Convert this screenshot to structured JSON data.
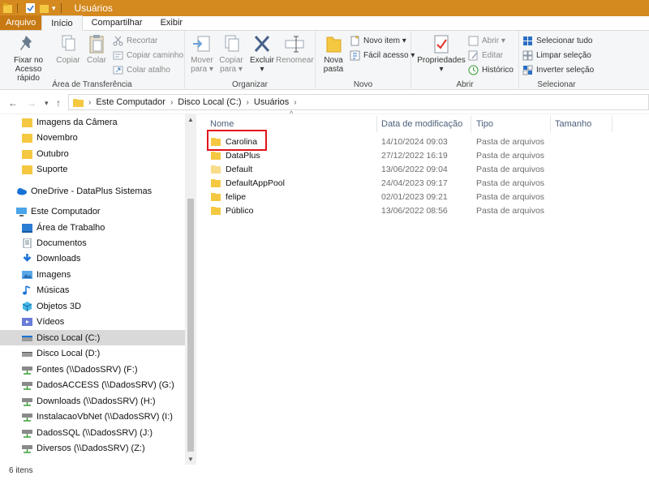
{
  "window": {
    "title": "Usuários"
  },
  "tabs": [
    "Arquivo",
    "Início",
    "Compartilhar",
    "Exibir"
  ],
  "ribbon": {
    "clipboard": {
      "label": "Área de Transferência",
      "pin_label1": "Fixar no",
      "pin_label2": "Acesso rápido",
      "copy_label": "Copiar",
      "paste_label": "Colar",
      "cut_label": "Recortar",
      "copy_path_label": "Copiar caminho",
      "paste_shortcut_label": "Colar atalho"
    },
    "organize": {
      "label": "Organizar",
      "move_label1": "Mover",
      "move_label2": "para ▾",
      "copy_to_label1": "Copiar",
      "copy_to_label2": "para ▾",
      "delete_label1": "Excluir",
      "delete_label2": "▾",
      "rename_label": "Renomear"
    },
    "new": {
      "label": "Novo",
      "new_folder_label1": "Nova",
      "new_folder_label2": "pasta",
      "new_item_label": "Novo item ▾",
      "easy_access_label": "Fácil acesso ▾"
    },
    "open": {
      "label": "Abrir",
      "properties_label1": "Propriedades",
      "properties_label2": "▾",
      "open_label": "Abrir ▾",
      "edit_label": "Editar",
      "history_label": "Histórico"
    },
    "select": {
      "label": "Selecionar",
      "select_all_label": "Selecionar tudo",
      "select_none_label": "Limpar seleção",
      "invert_label": "Inverter seleção"
    }
  },
  "address": {
    "crumbs": [
      "Este Computador",
      "Disco Local (C:)",
      "Usuários"
    ]
  },
  "nav": {
    "items": [
      {
        "label": "Imagens da Câmera",
        "icon": "folder-icon"
      },
      {
        "label": "Novembro",
        "icon": "folder-icon"
      },
      {
        "label": "Outubro",
        "icon": "folder-icon"
      },
      {
        "label": "Suporte",
        "icon": "folder-icon"
      },
      {
        "label": "OneDrive - DataPlus Sistemas",
        "icon": "onedrive-icon"
      },
      {
        "label": "Este Computador",
        "icon": "computer-icon"
      },
      {
        "label": "Área de Trabalho",
        "icon": "desktop-icon"
      },
      {
        "label": "Documentos",
        "icon": "documents-icon"
      },
      {
        "label": "Downloads",
        "icon": "downloads-icon"
      },
      {
        "label": "Imagens",
        "icon": "pictures-icon"
      },
      {
        "label": "Músicas",
        "icon": "music-icon"
      },
      {
        "label": "Objetos 3D",
        "icon": "3d-objects-icon"
      },
      {
        "label": "Vídeos",
        "icon": "videos-icon"
      },
      {
        "label": "Disco Local (C:)",
        "icon": "drive-icon"
      },
      {
        "label": "Disco Local (D:)",
        "icon": "drive-icon"
      },
      {
        "label": "Fontes (\\\\DadosSRV) (F:)",
        "icon": "network-drive-icon"
      },
      {
        "label": "DadosACCESS (\\\\DadosSRV) (G:)",
        "icon": "network-drive-icon"
      },
      {
        "label": "Downloads (\\\\DadosSRV) (H:)",
        "icon": "network-drive-icon"
      },
      {
        "label": "InstalacaoVbNet (\\\\DadosSRV) (I:)",
        "icon": "network-drive-icon"
      },
      {
        "label": "DadosSQL (\\\\DadosSRV) (J:)",
        "icon": "network-drive-icon"
      },
      {
        "label": "Diversos (\\\\DadosSRV) (Z:)",
        "icon": "network-drive-icon"
      }
    ]
  },
  "columns": {
    "name": "Nome",
    "date": "Data de modificação",
    "type": "Tipo",
    "size": "Tamanho"
  },
  "files": [
    {
      "name": "Carolina",
      "date": "14/10/2024 09:03",
      "type": "Pasta de arquivos"
    },
    {
      "name": "DataPlus",
      "date": "27/12/2022 16:19",
      "type": "Pasta de arquivos"
    },
    {
      "name": "Default",
      "date": "13/06/2022 09:04",
      "type": "Pasta de arquivos"
    },
    {
      "name": "DefaultAppPool",
      "date": "24/04/2023 09:17",
      "type": "Pasta de arquivos"
    },
    {
      "name": "felipe",
      "date": "02/01/2023 09:21",
      "type": "Pasta de arquivos"
    },
    {
      "name": "Público",
      "date": "13/06/2022 08:56",
      "type": "Pasta de arquivos"
    }
  ],
  "status": {
    "count": "6 itens"
  },
  "colors": {
    "titlebar": "#d48a1f",
    "file_tab": "#c77a14",
    "folder": "#f5c842",
    "highlight": "#e0131c"
  }
}
